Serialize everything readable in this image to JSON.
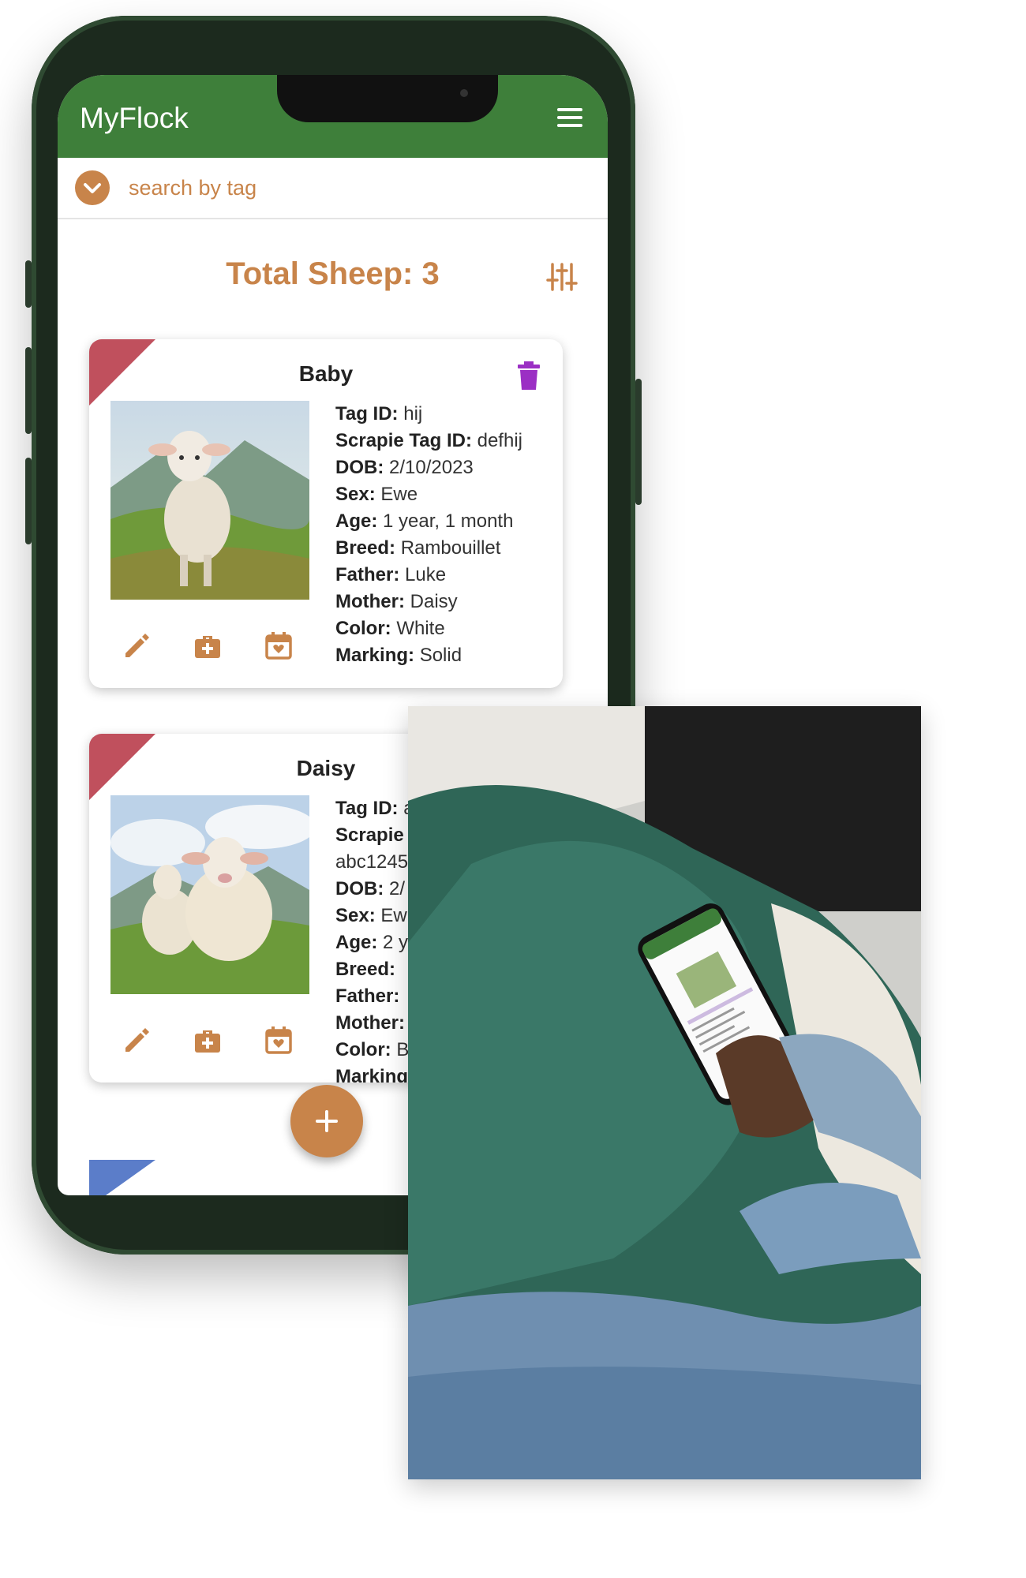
{
  "app": {
    "title": "MyFlock"
  },
  "search": {
    "placeholder": "search by tag"
  },
  "summary": {
    "total_label": "Total Sheep: 3"
  },
  "cards": [
    {
      "name": "Baby",
      "rows": [
        {
          "label": "Tag ID:",
          "value": "hij"
        },
        {
          "label": "Scrapie Tag ID:",
          "value": "defhij"
        },
        {
          "label": "DOB:",
          "value": "2/10/2023"
        },
        {
          "label": "Sex:",
          "value": "Ewe"
        },
        {
          "label": "Age:",
          "value": "1 year, 1 month"
        },
        {
          "label": "Breed:",
          "value": "Rambouillet"
        },
        {
          "label": "Father:",
          "value": "Luke"
        },
        {
          "label": "Mother:",
          "value": "Daisy"
        },
        {
          "label": "Color:",
          "value": "White"
        },
        {
          "label": "Marking:",
          "value": "Solid"
        }
      ]
    },
    {
      "name": "Daisy",
      "rows": [
        {
          "label": "Tag ID:",
          "value": "a"
        },
        {
          "label": "Scrapie",
          "value": ""
        },
        {
          "label": "",
          "value": "abc1245"
        },
        {
          "label": "DOB:",
          "value": "2/"
        },
        {
          "label": "Sex:",
          "value": "Ew"
        },
        {
          "label": "Age:",
          "value": "2 y"
        },
        {
          "label": "Breed:",
          "value": ""
        },
        {
          "label": "Father:",
          "value": ""
        },
        {
          "label": "Mother:",
          "value": ""
        },
        {
          "label": "Color:",
          "value": "B"
        },
        {
          "label": "Marking",
          "value": ""
        }
      ]
    }
  ],
  "colors": {
    "appbar": "#3e7f3a",
    "accent": "#c8844a",
    "corner_red": "#c0505d",
    "corner_blue": "#5b7dc9",
    "trash_purple": "#9b2fc4"
  },
  "icons": {
    "menu": "menu-icon",
    "search_toggle": "chevron-down-icon",
    "filter": "sliders-icon",
    "trash": "trash-icon",
    "edit": "pencil-icon",
    "medical": "medical-bag-icon",
    "calendar": "calendar-icon",
    "fab": "plus-icon"
  }
}
